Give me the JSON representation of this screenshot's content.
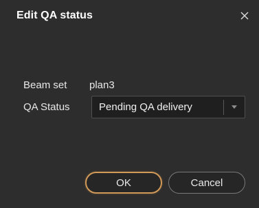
{
  "dialog": {
    "title": "Edit QA status"
  },
  "form": {
    "beam_set_label": "Beam set",
    "beam_set_value": "plan3",
    "qa_status_label": "QA Status",
    "qa_status_value": "Pending QA delivery"
  },
  "buttons": {
    "ok_label": "OK",
    "cancel_label": "Cancel"
  },
  "icons": {
    "close": "close-icon",
    "dropdown": "chevron-down-icon"
  },
  "colors": {
    "background": "#2d2d2d",
    "select_background": "#1f1f1f",
    "accent": "#d29a57",
    "text": "#e6e6e6"
  }
}
